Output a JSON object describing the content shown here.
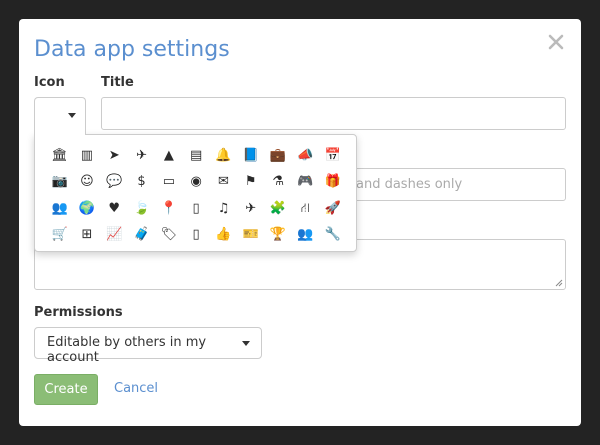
{
  "modal": {
    "title": "Data app settings",
    "close_label": "×"
  },
  "labels": {
    "icon": "Icon",
    "title": "Title",
    "permissions": "Permissions"
  },
  "fields": {
    "title_value": "",
    "slug_placeholder_visible": "and dashes only",
    "description_value": ""
  },
  "permissions": {
    "selected": "Editable by others in my account"
  },
  "buttons": {
    "create": "Create",
    "cancel": "Cancel"
  },
  "icon_picker": {
    "icons": [
      {
        "name": "bank-icon",
        "glyph": "🏛"
      },
      {
        "name": "building-icon",
        "glyph": "▥"
      },
      {
        "name": "paper-plane-icon",
        "glyph": "➤"
      },
      {
        "name": "fighter-jet-icon",
        "glyph": "✈"
      },
      {
        "name": "tree-icon",
        "glyph": "▲"
      },
      {
        "name": "archive-icon",
        "glyph": "▤"
      },
      {
        "name": "bell-icon",
        "glyph": "🔔"
      },
      {
        "name": "book-icon",
        "glyph": "📘"
      },
      {
        "name": "briefcase-icon",
        "glyph": "💼"
      },
      {
        "name": "bullhorn-icon",
        "glyph": "📣"
      },
      {
        "name": "calendar-icon",
        "glyph": "📅"
      },
      {
        "name": "camera-icon",
        "glyph": "📷"
      },
      {
        "name": "child-icon",
        "glyph": "☺"
      },
      {
        "name": "comments-icon",
        "glyph": "💬"
      },
      {
        "name": "dollar-icon",
        "glyph": "$"
      },
      {
        "name": "credit-card-icon",
        "glyph": "▭"
      },
      {
        "name": "compass-icon",
        "glyph": "◉"
      },
      {
        "name": "envelope-icon",
        "glyph": "✉"
      },
      {
        "name": "flag-icon",
        "glyph": "⚑"
      },
      {
        "name": "flask-icon",
        "glyph": "⚗"
      },
      {
        "name": "gamepad-icon",
        "glyph": "🎮"
      },
      {
        "name": "gift-icon",
        "glyph": "🎁"
      },
      {
        "name": "users-icon",
        "glyph": "👥"
      },
      {
        "name": "globe-icon",
        "glyph": "🌍"
      },
      {
        "name": "heart-icon",
        "glyph": "♥"
      },
      {
        "name": "leaf-icon",
        "glyph": "🍃"
      },
      {
        "name": "map-marker-icon",
        "glyph": "📍"
      },
      {
        "name": "mobile-icon",
        "glyph": "▯"
      },
      {
        "name": "music-icon",
        "glyph": "♫"
      },
      {
        "name": "plane-icon",
        "glyph": "✈"
      },
      {
        "name": "puzzle-icon",
        "glyph": "🧩"
      },
      {
        "name": "road-icon",
        "glyph": "⛙"
      },
      {
        "name": "rocket-icon",
        "glyph": "🚀"
      },
      {
        "name": "shopping-cart-icon",
        "glyph": "🛒"
      },
      {
        "name": "sitemap-icon",
        "glyph": "⊞"
      },
      {
        "name": "line-chart-icon",
        "glyph": "📈"
      },
      {
        "name": "suitcase-icon",
        "glyph": "🧳"
      },
      {
        "name": "tags-icon",
        "glyph": "🏷"
      },
      {
        "name": "tablet-icon",
        "glyph": "▯"
      },
      {
        "name": "thumbs-up-icon",
        "glyph": "👍"
      },
      {
        "name": "ticket-icon",
        "glyph": "🎫"
      },
      {
        "name": "trophy-icon",
        "glyph": "🏆"
      },
      {
        "name": "group-icon",
        "glyph": "👥"
      },
      {
        "name": "wrench-icon",
        "glyph": "🔧"
      }
    ]
  }
}
